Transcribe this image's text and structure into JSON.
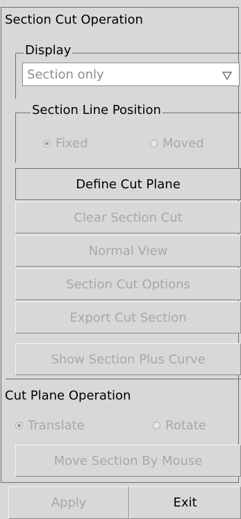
{
  "section_cut": {
    "title": "Section Cut Operation",
    "display": {
      "legend": "Display",
      "selected": "Section only"
    },
    "line_position": {
      "legend": "Section Line Position",
      "options": [
        {
          "label": "Fixed",
          "checked": true
        },
        {
          "label": "Moved",
          "checked": false
        }
      ]
    },
    "buttons": {
      "define": "Define Cut Plane",
      "clear": "Clear Section Cut",
      "normal": "Normal View",
      "options": "Section Cut Options",
      "export": "Export Cut Section",
      "show_curve": "Show Section Plus Curve"
    }
  },
  "cut_plane": {
    "title": "Cut Plane Operation",
    "options": [
      {
        "label": "Translate",
        "checked": true
      },
      {
        "label": "Rotate",
        "checked": false
      }
    ],
    "move_button": "Move Section By Mouse"
  },
  "footer": {
    "apply": "Apply",
    "exit": "Exit"
  },
  "colors": {
    "background": "#d8d8d8",
    "disabled_text": "#a8a8a8",
    "border": "#6e6e6e"
  }
}
